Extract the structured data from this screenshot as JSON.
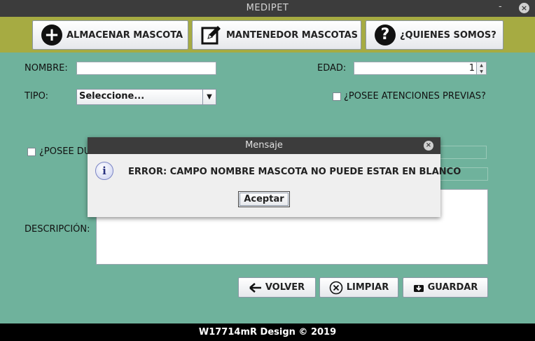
{
  "window": {
    "title": "MEDIPET",
    "minimize": "-",
    "close": "×"
  },
  "toolbar": {
    "store_label": "ALMACENAR MASCOTA",
    "maintain_label": "MANTENEDOR MASCOTAS",
    "about_label": "¿QUIENES SOMOS?"
  },
  "form": {
    "name_label": "NOMBRE:",
    "name_value": "",
    "age_label": "EDAD:",
    "age_value": "1",
    "type_label": "TIPO:",
    "type_selected": "Seleccione...",
    "prior_care_label": "¿POSEE ATENCIONES PREVIAS?",
    "owner_check_label": "¿POSEE DU",
    "description_label": "DESCRIPCIÓN:",
    "description_value": ""
  },
  "actions": {
    "back_label": "VOLVER",
    "clear_label": "LIMPIAR",
    "save_label": "GUARDAR"
  },
  "footer": {
    "text": "W17714mR Design © 2019"
  },
  "dialog": {
    "title": "Mensaje",
    "close": "×",
    "info_icon": "i",
    "message": "ERROR: CAMPO NOMBRE MASCOTA NO PUEDE ESTAR EN BLANCO",
    "ok_label": "Aceptar"
  },
  "colors": {
    "background": "#6fb29c",
    "toolbar": "#a6ab42",
    "titlebar": "#3c3c3c",
    "footer": "#000000"
  }
}
